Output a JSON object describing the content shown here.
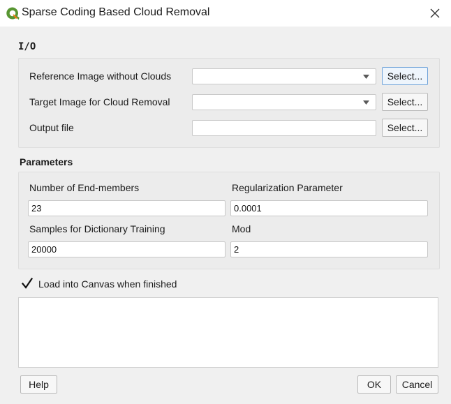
{
  "window": {
    "title": "Sparse Coding Based Cloud Removal",
    "app_icon": "qgis-logo-icon",
    "close_glyph": "✕",
    "colors": {
      "accent": "#589632",
      "focus_border": "#6fa2d8"
    }
  },
  "io": {
    "title": "I/O",
    "reference": {
      "label": "Reference Image without Clouds",
      "value": "",
      "button": "Select..."
    },
    "target": {
      "label": "Target Image for Cloud Removal",
      "value": "",
      "button": "Select..."
    },
    "output": {
      "label": "Output file",
      "value": "",
      "button": "Select..."
    }
  },
  "parameters": {
    "title": "Parameters",
    "endmembers": {
      "label": "Number of End-members",
      "value": "23"
    },
    "regularization": {
      "label": "Regularization Parameter",
      "value": "0.0001"
    },
    "samples": {
      "label": "Samples for Dictionary Training",
      "value": "20000"
    },
    "mod": {
      "label": "Mod",
      "value": "2"
    }
  },
  "options": {
    "load_into_canvas": {
      "label": "Load into Canvas when finished",
      "checked": true
    }
  },
  "log": {
    "text": ""
  },
  "footer": {
    "help": "Help",
    "ok": "OK",
    "cancel": "Cancel"
  }
}
